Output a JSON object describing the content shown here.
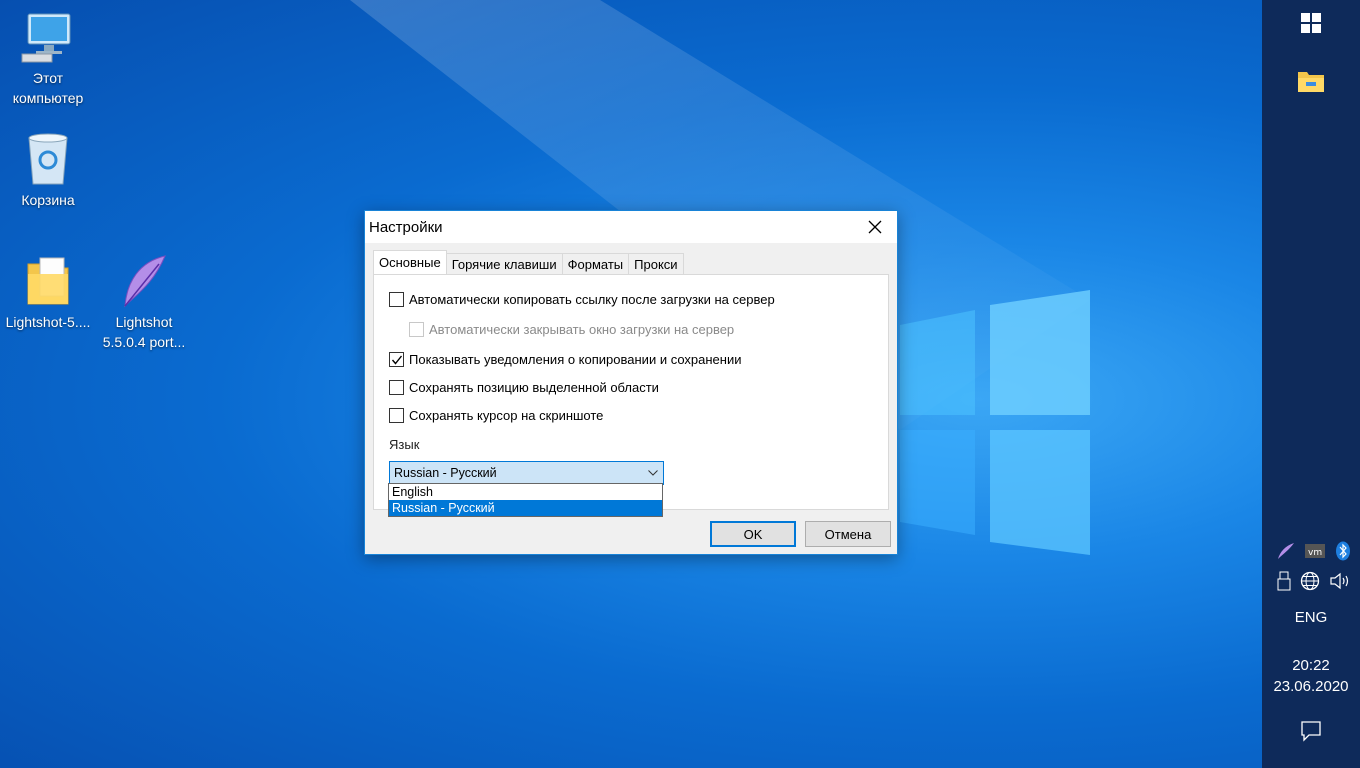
{
  "desktop": {
    "icons": [
      {
        "label_line1": "Этот",
        "label_line2": "компьютер",
        "icon": "computer-icon"
      },
      {
        "label_line1": "Корзина",
        "label_line2": "",
        "icon": "recycle-bin-icon"
      },
      {
        "label_line1": "Lightshot-5....",
        "label_line2": "",
        "icon": "folder-icon"
      },
      {
        "label_line1": "Lightshot",
        "label_line2": "5.5.0.4 port...",
        "icon": "feather-icon"
      }
    ]
  },
  "dialog": {
    "title": "Настройки",
    "tabs": [
      {
        "label": "Основные",
        "active": true
      },
      {
        "label": "Горячие клавиши",
        "active": false
      },
      {
        "label": "Форматы",
        "active": false
      },
      {
        "label": "Прокси",
        "active": false
      }
    ],
    "options": [
      {
        "label": "Автоматически копировать ссылку после загрузки на сервер",
        "checked": false,
        "enabled": true
      },
      {
        "label": "Автоматически закрывать окно загрузки на сервер",
        "checked": false,
        "enabled": false
      },
      {
        "label": "Показывать уведомления о копировании и сохранении",
        "checked": true,
        "enabled": true
      },
      {
        "label": "Сохранять позицию выделенной области",
        "checked": false,
        "enabled": true
      },
      {
        "label": "Сохранять курсор на скриншоте",
        "checked": false,
        "enabled": true
      }
    ],
    "language_label": "Язык",
    "language_selected": "Russian - Русский",
    "language_options": [
      "English",
      "Russian - Русский"
    ],
    "ok_label": "OK",
    "cancel_label": "Отмена"
  },
  "taskbar": {
    "language": "ENG",
    "time": "20:22",
    "date": "23.06.2020",
    "tray_icons": [
      "lightshot-icon",
      "vmware-icon",
      "bluetooth-icon",
      "usb-icon",
      "network-icon",
      "volume-icon"
    ]
  }
}
